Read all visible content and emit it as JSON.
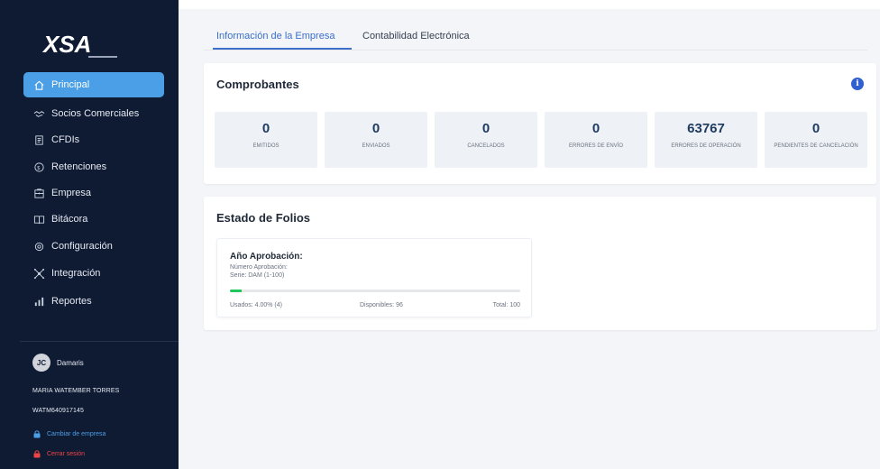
{
  "brand": {
    "logo_text": "XSA"
  },
  "sidebar": {
    "items": [
      {
        "label": "Principal",
        "icon": "home-icon",
        "active": true
      },
      {
        "label": "Socios Comerciales",
        "icon": "handshake-icon",
        "active": false
      },
      {
        "label": "CFDIs",
        "icon": "document-icon",
        "active": false
      },
      {
        "label": "Retenciones",
        "icon": "retention-icon",
        "active": false
      },
      {
        "label": "Empresa",
        "icon": "building-icon",
        "active": false
      },
      {
        "label": "Bitácora",
        "icon": "book-icon",
        "active": false
      },
      {
        "label": "Configuración",
        "icon": "gear-icon",
        "active": false
      },
      {
        "label": "Integración",
        "icon": "integration-icon",
        "active": false
      },
      {
        "label": "Reportes",
        "icon": "chart-icon",
        "active": false
      }
    ],
    "user": {
      "initials": "JC",
      "name": "Damaris",
      "full_name": "MARIA WATEMBER TORRES",
      "rfc": "WATM640917145",
      "change_company": "Cambiar de empresa",
      "logout": "Cerrar sesión"
    }
  },
  "tabs": [
    {
      "label": "Información de la Empresa",
      "active": true
    },
    {
      "label": "Contabilidad Electrónica",
      "active": false
    }
  ],
  "comprobantes": {
    "title": "Comprobantes",
    "stats": [
      {
        "value": "0",
        "label": "EMITIDOS"
      },
      {
        "value": "0",
        "label": "ENVIADOS"
      },
      {
        "value": "0",
        "label": "CANCELADOS"
      },
      {
        "value": "0",
        "label": "ERRORES DE ENVÍO"
      },
      {
        "value": "63767",
        "label": "ERRORES DE OPERACIÓN"
      },
      {
        "value": "0",
        "label": "PENDIENTES DE CANCELACIÓN"
      }
    ]
  },
  "folios": {
    "title": "Estado de Folios",
    "card": {
      "title": "Año Aprobación:",
      "number": "Número Aprobación:",
      "serie": "Serie: DAM (1-100)",
      "usados": "Usados: 4.00% (4)",
      "disponibles": "Disponibles: 96",
      "total": "Total: 100",
      "progress_percent": 4
    }
  },
  "colors": {
    "sidebar_bg": "#0f1b33",
    "active_item": "#4b9fe6",
    "accent": "#3b6fc9",
    "progress": "#22c55e",
    "danger": "#ef4444"
  }
}
